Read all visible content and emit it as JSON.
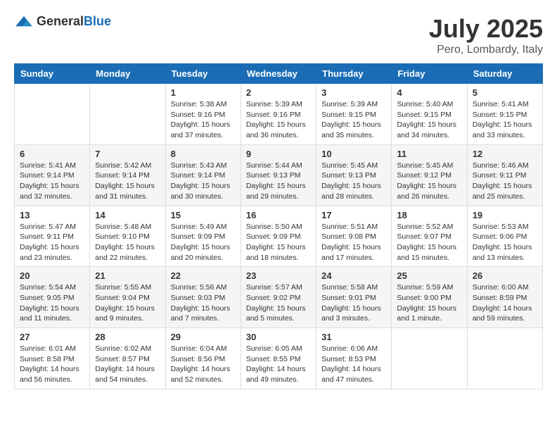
{
  "header": {
    "logo_general": "General",
    "logo_blue": "Blue",
    "month_title": "July 2025",
    "location": "Pero, Lombardy, Italy"
  },
  "days_of_week": [
    "Sunday",
    "Monday",
    "Tuesday",
    "Wednesday",
    "Thursday",
    "Friday",
    "Saturday"
  ],
  "weeks": [
    [
      {
        "day": "",
        "info": ""
      },
      {
        "day": "",
        "info": ""
      },
      {
        "day": "1",
        "info": "Sunrise: 5:38 AM\nSunset: 9:16 PM\nDaylight: 15 hours\nand 37 minutes."
      },
      {
        "day": "2",
        "info": "Sunrise: 5:39 AM\nSunset: 9:16 PM\nDaylight: 15 hours\nand 36 minutes."
      },
      {
        "day": "3",
        "info": "Sunrise: 5:39 AM\nSunset: 9:15 PM\nDaylight: 15 hours\nand 35 minutes."
      },
      {
        "day": "4",
        "info": "Sunrise: 5:40 AM\nSunset: 9:15 PM\nDaylight: 15 hours\nand 34 minutes."
      },
      {
        "day": "5",
        "info": "Sunrise: 5:41 AM\nSunset: 9:15 PM\nDaylight: 15 hours\nand 33 minutes."
      }
    ],
    [
      {
        "day": "6",
        "info": "Sunrise: 5:41 AM\nSunset: 9:14 PM\nDaylight: 15 hours\nand 32 minutes."
      },
      {
        "day": "7",
        "info": "Sunrise: 5:42 AM\nSunset: 9:14 PM\nDaylight: 15 hours\nand 31 minutes."
      },
      {
        "day": "8",
        "info": "Sunrise: 5:43 AM\nSunset: 9:14 PM\nDaylight: 15 hours\nand 30 minutes."
      },
      {
        "day": "9",
        "info": "Sunrise: 5:44 AM\nSunset: 9:13 PM\nDaylight: 15 hours\nand 29 minutes."
      },
      {
        "day": "10",
        "info": "Sunrise: 5:45 AM\nSunset: 9:13 PM\nDaylight: 15 hours\nand 28 minutes."
      },
      {
        "day": "11",
        "info": "Sunrise: 5:45 AM\nSunset: 9:12 PM\nDaylight: 15 hours\nand 26 minutes."
      },
      {
        "day": "12",
        "info": "Sunrise: 5:46 AM\nSunset: 9:11 PM\nDaylight: 15 hours\nand 25 minutes."
      }
    ],
    [
      {
        "day": "13",
        "info": "Sunrise: 5:47 AM\nSunset: 9:11 PM\nDaylight: 15 hours\nand 23 minutes."
      },
      {
        "day": "14",
        "info": "Sunrise: 5:48 AM\nSunset: 9:10 PM\nDaylight: 15 hours\nand 22 minutes."
      },
      {
        "day": "15",
        "info": "Sunrise: 5:49 AM\nSunset: 9:09 PM\nDaylight: 15 hours\nand 20 minutes."
      },
      {
        "day": "16",
        "info": "Sunrise: 5:50 AM\nSunset: 9:09 PM\nDaylight: 15 hours\nand 18 minutes."
      },
      {
        "day": "17",
        "info": "Sunrise: 5:51 AM\nSunset: 9:08 PM\nDaylight: 15 hours\nand 17 minutes."
      },
      {
        "day": "18",
        "info": "Sunrise: 5:52 AM\nSunset: 9:07 PM\nDaylight: 15 hours\nand 15 minutes."
      },
      {
        "day": "19",
        "info": "Sunrise: 5:53 AM\nSunset: 9:06 PM\nDaylight: 15 hours\nand 13 minutes."
      }
    ],
    [
      {
        "day": "20",
        "info": "Sunrise: 5:54 AM\nSunset: 9:05 PM\nDaylight: 15 hours\nand 11 minutes."
      },
      {
        "day": "21",
        "info": "Sunrise: 5:55 AM\nSunset: 9:04 PM\nDaylight: 15 hours\nand 9 minutes."
      },
      {
        "day": "22",
        "info": "Sunrise: 5:56 AM\nSunset: 9:03 PM\nDaylight: 15 hours\nand 7 minutes."
      },
      {
        "day": "23",
        "info": "Sunrise: 5:57 AM\nSunset: 9:02 PM\nDaylight: 15 hours\nand 5 minutes."
      },
      {
        "day": "24",
        "info": "Sunrise: 5:58 AM\nSunset: 9:01 PM\nDaylight: 15 hours\nand 3 minutes."
      },
      {
        "day": "25",
        "info": "Sunrise: 5:59 AM\nSunset: 9:00 PM\nDaylight: 15 hours\nand 1 minute."
      },
      {
        "day": "26",
        "info": "Sunrise: 6:00 AM\nSunset: 8:59 PM\nDaylight: 14 hours\nand 59 minutes."
      }
    ],
    [
      {
        "day": "27",
        "info": "Sunrise: 6:01 AM\nSunset: 8:58 PM\nDaylight: 14 hours\nand 56 minutes."
      },
      {
        "day": "28",
        "info": "Sunrise: 6:02 AM\nSunset: 8:57 PM\nDaylight: 14 hours\nand 54 minutes."
      },
      {
        "day": "29",
        "info": "Sunrise: 6:04 AM\nSunset: 8:56 PM\nDaylight: 14 hours\nand 52 minutes."
      },
      {
        "day": "30",
        "info": "Sunrise: 6:05 AM\nSunset: 8:55 PM\nDaylight: 14 hours\nand 49 minutes."
      },
      {
        "day": "31",
        "info": "Sunrise: 6:06 AM\nSunset: 8:53 PM\nDaylight: 14 hours\nand 47 minutes."
      },
      {
        "day": "",
        "info": ""
      },
      {
        "day": "",
        "info": ""
      }
    ]
  ]
}
